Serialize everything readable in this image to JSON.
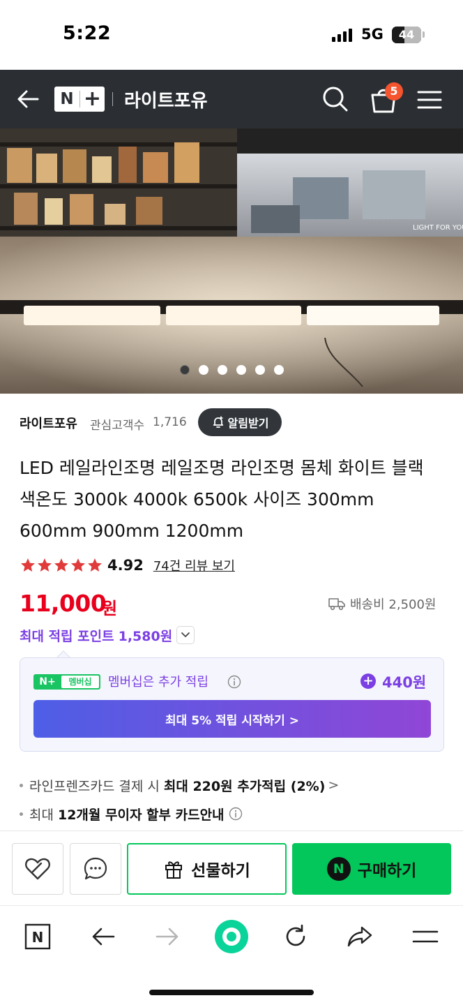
{
  "status_bar": {
    "time": "5:22",
    "network": "5G",
    "battery": "44",
    "battery_level": 0.44
  },
  "header": {
    "logo_n": "N",
    "logo_plus": "+",
    "store_name": "라이트포유",
    "cart_count": "5",
    "icons": [
      "back-arrow-icon",
      "search-icon",
      "cart-icon",
      "menu-icon"
    ]
  },
  "carousel": {
    "total_slides": 6,
    "active_index": 0
  },
  "seller": {
    "name": "라이트포유",
    "followers_label": "관심고객수",
    "followers": "1,716",
    "alarm_label": "알림받기"
  },
  "product": {
    "title": "LED 레일라인조명 레일조명 라인조명 몸체 화이트 블랙 색온도 3000k 4000k 6500k 사이즈 300mm 600mm 900mm 1200mm",
    "rating": "4.92",
    "stars": 5,
    "review_link": "74건 리뷰 보기",
    "price": "11,000",
    "price_unit": "원",
    "shipping": "배송비 2,500원",
    "points_label": "최대 적립 포인트",
    "points_value": "1,580원"
  },
  "membership": {
    "badge_np": "N+",
    "badge_label": "멤버십",
    "text": "멤버십은 추가 적립",
    "points": "440원",
    "cta": "최대 5% 적립 시작하기 >"
  },
  "benefits": [
    {
      "prefix": "라인프렌즈카드 결제 시",
      "bold": "최대 220원 추가적립 (2%)",
      "suffix": ">"
    },
    {
      "prefix": "최대",
      "bold": "12개월 무이자 할부 카드안내",
      "suffix": ""
    }
  ],
  "actions": {
    "gift_label": "선물하기",
    "buy_label": "구매하기",
    "buy_n": "N"
  },
  "browser_toolbar": {
    "home_n": "N",
    "icons": [
      "naver-home-icon",
      "back-icon",
      "forward-icon",
      "green-dot-icon",
      "reload-icon",
      "share-icon",
      "menu-icon"
    ]
  },
  "colors": {
    "header_bg": "#2b2f33",
    "price_red": "#e8001c",
    "points_purple": "#7b3fe4",
    "naver_green": "#03c75a",
    "cart_badge": "#f5542f"
  }
}
